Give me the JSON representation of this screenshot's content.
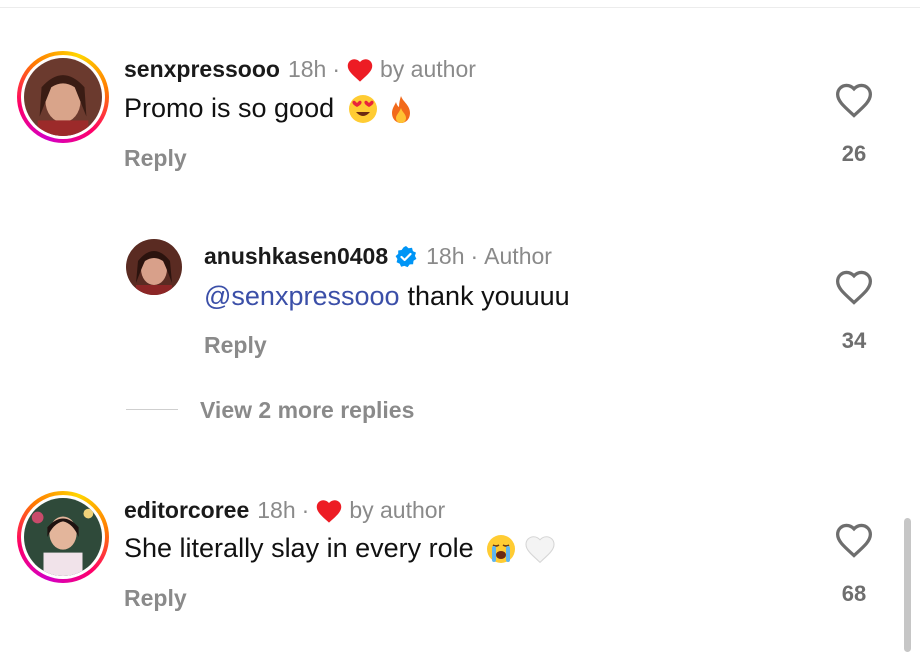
{
  "comments": [
    {
      "username": "senxpressooo",
      "time": "18h",
      "dot": "·",
      "liked_by_author_label": "by author",
      "text": "Promo is so good",
      "emojis": [
        "heart-eyes-emoji",
        "fire-emoji"
      ],
      "reply_label": "Reply",
      "likes": "26"
    },
    {
      "username": "anushkasen0408",
      "verified": true,
      "time": "18h",
      "dot": "·",
      "author_label": "Author",
      "mention": "@senxpressooo",
      "text": "thank youuuu",
      "reply_label": "Reply",
      "likes": "34"
    },
    {
      "username": "editorcoree",
      "time": "18h",
      "dot": "·",
      "liked_by_author_label": "by author",
      "text": "She literally slay in every role",
      "emojis": [
        "loudly-crying-emoji",
        "white-heart-emoji"
      ],
      "reply_label": "Reply",
      "likes": "68"
    }
  ],
  "view_more_replies": "View 2 more replies",
  "colors": {
    "heart_red": "#ed1c24",
    "muted_text": "#8a8a8a",
    "mention_blue": "#3b4fa8",
    "verified_blue": "#0095f6"
  }
}
